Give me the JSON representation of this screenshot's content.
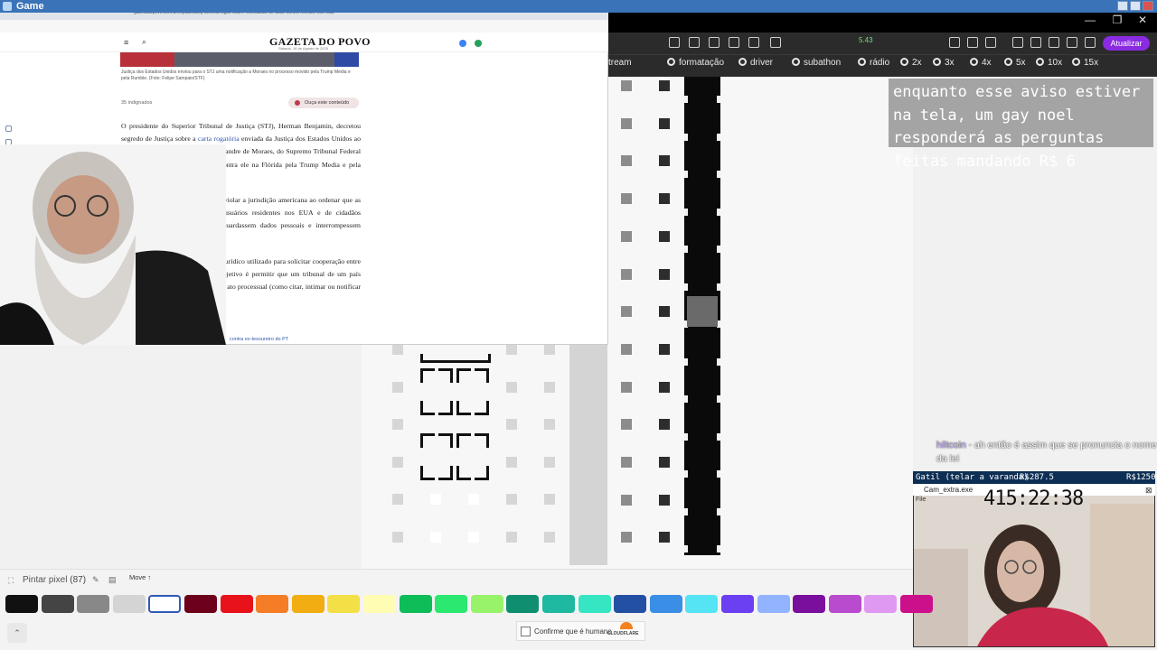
{
  "window_title": "Game",
  "right_browser": {
    "update_button": "Atualizar",
    "counter": "5.43",
    "bookmarks": [
      "tream",
      "formatação",
      "driver",
      "subathon",
      "rádio",
      "2x",
      "3x",
      "4x",
      "5x",
      "10x",
      "15x"
    ]
  },
  "chat_overlay": {
    "alert_text": "enquanto esse aviso estiver na tela, um gay noel responderá as perguntas feitas mandando R$ 6",
    "ticker_user": "hiltcoin",
    "ticker_text": "ah então é assim que se pronuncia o nome da lei"
  },
  "donation_bar": {
    "name": "Gatil (telar a varanda)",
    "amount": "R$287.5",
    "goal": "R$1250"
  },
  "webcam2": {
    "window_title": "Cam_extra.exe",
    "menu": "File",
    "timer": "415:22:38"
  },
  "toolbar": {
    "tool_label": "Pintar pixel",
    "tool_count": "(87)",
    "move_label": "Move ↑"
  },
  "palette": {
    "colors": [
      "#111111",
      "#444444",
      "#888888",
      "#d4d4d4",
      "#ffffff",
      "#6d001a",
      "#e8121b",
      "#f57d26",
      "#f2ad12",
      "#f3e047",
      "#fffdb3",
      "#0fbd58",
      "#2be870",
      "#98f26a",
      "#0f8f6f",
      "#1fb8a0",
      "#36e5c1",
      "#2450a4",
      "#3a8ee6",
      "#55e4f4",
      "#6b3ff2",
      "#92b3ff",
      "#7a0f9e",
      "#b94bce",
      "#e099f2",
      "#cc0f8a"
    ],
    "selected_index": 4
  },
  "captcha": {
    "label": "Confirme que é humano",
    "brand": "CLOUDFLARE"
  },
  "article": {
    "url": "gazetadopovo.com.br/republica/stj-decreta-sigilo-sobre-notificacao-de-acao-contra-moraes-nos-eua/",
    "site_name": "GAZETA DO POVO",
    "dateline": "Sábado, 16 de Agosto de 2025",
    "caption": "Justiça dos Estados Unidos enviou para o STJ uma notificação a Moraes no processo movido pela Trump Media e pela Rumble. (Foto: Felipe Sampaio/STF)",
    "likes": "35 indignados",
    "listen_button": "Ouça este conteúdo",
    "para1_a": "O presidente do Superior Tribunal de Justiça (STJ), Herman Benjamin, decretou segredo de Justiça sobre a ",
    "para1_link": "carta rogatória",
    "para1_b": " enviada da Justiça dos Estados Unidos ao Brasil para notificar o ministro Alexandre de Moraes, do Supremo Tribunal Federal (STF), sobre o processo movido contra ele na Flórida pela Trump Media e pela Rumble.",
    "para2": "As empresas acusam o ministro de violar a jurisdição americana ao ordenar que as empresas bloqueassem perfis de usuários residentes nos EUA e de cidadãos americanos, além de exigir que guardassem dados pessoais e interrompessem monetização de suas contas.",
    "para3": "A carta rogatória é um instrumento jurídico utilizado para solicitar cooperação entre tribunais de diferentes países. O objetivo é permitir que um tribunal de um país solicite a outro país que pratique um ato processual (como citar, intimar ou notificar alguém que está no exterior).",
    "related_link": "contra ex-tesoureiro do PT"
  }
}
